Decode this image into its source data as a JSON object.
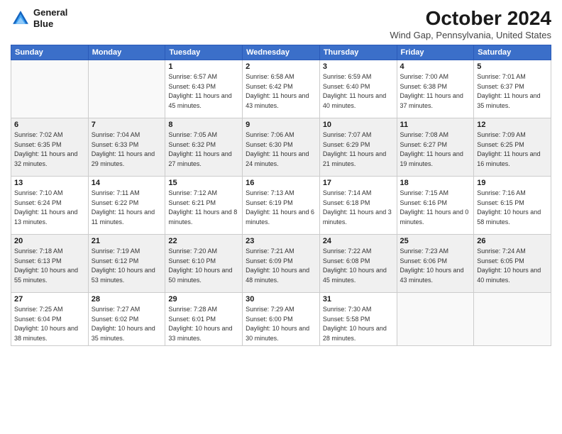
{
  "header": {
    "logo_line1": "General",
    "logo_line2": "Blue",
    "month": "October 2024",
    "location": "Wind Gap, Pennsylvania, United States"
  },
  "weekdays": [
    "Sunday",
    "Monday",
    "Tuesday",
    "Wednesday",
    "Thursday",
    "Friday",
    "Saturday"
  ],
  "weeks": [
    [
      {
        "day": "",
        "info": ""
      },
      {
        "day": "",
        "info": ""
      },
      {
        "day": "1",
        "info": "Sunrise: 6:57 AM\nSunset: 6:43 PM\nDaylight: 11 hours and 45 minutes."
      },
      {
        "day": "2",
        "info": "Sunrise: 6:58 AM\nSunset: 6:42 PM\nDaylight: 11 hours and 43 minutes."
      },
      {
        "day": "3",
        "info": "Sunrise: 6:59 AM\nSunset: 6:40 PM\nDaylight: 11 hours and 40 minutes."
      },
      {
        "day": "4",
        "info": "Sunrise: 7:00 AM\nSunset: 6:38 PM\nDaylight: 11 hours and 37 minutes."
      },
      {
        "day": "5",
        "info": "Sunrise: 7:01 AM\nSunset: 6:37 PM\nDaylight: 11 hours and 35 minutes."
      }
    ],
    [
      {
        "day": "6",
        "info": "Sunrise: 7:02 AM\nSunset: 6:35 PM\nDaylight: 11 hours and 32 minutes."
      },
      {
        "day": "7",
        "info": "Sunrise: 7:04 AM\nSunset: 6:33 PM\nDaylight: 11 hours and 29 minutes."
      },
      {
        "day": "8",
        "info": "Sunrise: 7:05 AM\nSunset: 6:32 PM\nDaylight: 11 hours and 27 minutes."
      },
      {
        "day": "9",
        "info": "Sunrise: 7:06 AM\nSunset: 6:30 PM\nDaylight: 11 hours and 24 minutes."
      },
      {
        "day": "10",
        "info": "Sunrise: 7:07 AM\nSunset: 6:29 PM\nDaylight: 11 hours and 21 minutes."
      },
      {
        "day": "11",
        "info": "Sunrise: 7:08 AM\nSunset: 6:27 PM\nDaylight: 11 hours and 19 minutes."
      },
      {
        "day": "12",
        "info": "Sunrise: 7:09 AM\nSunset: 6:25 PM\nDaylight: 11 hours and 16 minutes."
      }
    ],
    [
      {
        "day": "13",
        "info": "Sunrise: 7:10 AM\nSunset: 6:24 PM\nDaylight: 11 hours and 13 minutes."
      },
      {
        "day": "14",
        "info": "Sunrise: 7:11 AM\nSunset: 6:22 PM\nDaylight: 11 hours and 11 minutes."
      },
      {
        "day": "15",
        "info": "Sunrise: 7:12 AM\nSunset: 6:21 PM\nDaylight: 11 hours and 8 minutes."
      },
      {
        "day": "16",
        "info": "Sunrise: 7:13 AM\nSunset: 6:19 PM\nDaylight: 11 hours and 6 minutes."
      },
      {
        "day": "17",
        "info": "Sunrise: 7:14 AM\nSunset: 6:18 PM\nDaylight: 11 hours and 3 minutes."
      },
      {
        "day": "18",
        "info": "Sunrise: 7:15 AM\nSunset: 6:16 PM\nDaylight: 11 hours and 0 minutes."
      },
      {
        "day": "19",
        "info": "Sunrise: 7:16 AM\nSunset: 6:15 PM\nDaylight: 10 hours and 58 minutes."
      }
    ],
    [
      {
        "day": "20",
        "info": "Sunrise: 7:18 AM\nSunset: 6:13 PM\nDaylight: 10 hours and 55 minutes."
      },
      {
        "day": "21",
        "info": "Sunrise: 7:19 AM\nSunset: 6:12 PM\nDaylight: 10 hours and 53 minutes."
      },
      {
        "day": "22",
        "info": "Sunrise: 7:20 AM\nSunset: 6:10 PM\nDaylight: 10 hours and 50 minutes."
      },
      {
        "day": "23",
        "info": "Sunrise: 7:21 AM\nSunset: 6:09 PM\nDaylight: 10 hours and 48 minutes."
      },
      {
        "day": "24",
        "info": "Sunrise: 7:22 AM\nSunset: 6:08 PM\nDaylight: 10 hours and 45 minutes."
      },
      {
        "day": "25",
        "info": "Sunrise: 7:23 AM\nSunset: 6:06 PM\nDaylight: 10 hours and 43 minutes."
      },
      {
        "day": "26",
        "info": "Sunrise: 7:24 AM\nSunset: 6:05 PM\nDaylight: 10 hours and 40 minutes."
      }
    ],
    [
      {
        "day": "27",
        "info": "Sunrise: 7:25 AM\nSunset: 6:04 PM\nDaylight: 10 hours and 38 minutes."
      },
      {
        "day": "28",
        "info": "Sunrise: 7:27 AM\nSunset: 6:02 PM\nDaylight: 10 hours and 35 minutes."
      },
      {
        "day": "29",
        "info": "Sunrise: 7:28 AM\nSunset: 6:01 PM\nDaylight: 10 hours and 33 minutes."
      },
      {
        "day": "30",
        "info": "Sunrise: 7:29 AM\nSunset: 6:00 PM\nDaylight: 10 hours and 30 minutes."
      },
      {
        "day": "31",
        "info": "Sunrise: 7:30 AM\nSunset: 5:58 PM\nDaylight: 10 hours and 28 minutes."
      },
      {
        "day": "",
        "info": ""
      },
      {
        "day": "",
        "info": ""
      }
    ]
  ]
}
